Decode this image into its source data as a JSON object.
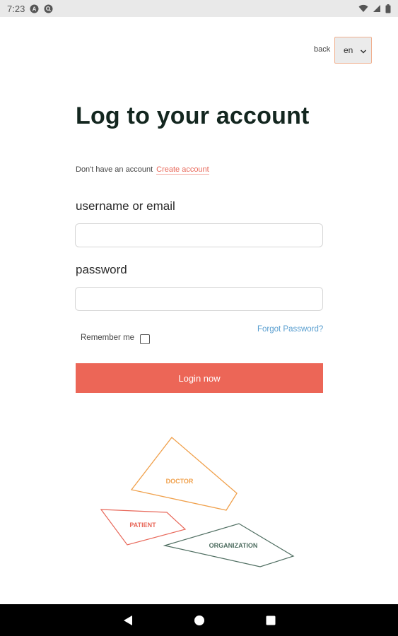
{
  "status_bar": {
    "time": "7:23",
    "left_icons": [
      "notification-a-icon",
      "search-badge-icon"
    ],
    "right_icons": [
      "wifi-icon",
      "signal-icon",
      "battery-icon"
    ]
  },
  "header": {
    "back_label": "back",
    "language": {
      "selected": "en"
    }
  },
  "page_title": "Log to your account",
  "signup": {
    "prompt": "Don't have an account",
    "link_label": "Create account"
  },
  "form": {
    "username_label": "username or email",
    "username_value": "",
    "password_label": "password",
    "password_value": "",
    "remember_label": "Remember me",
    "remember_checked": false,
    "forgot_label": "Forgot Password?",
    "login_label": "Login now"
  },
  "roles": {
    "doctor": "DOCTOR",
    "patient": "PATIENT",
    "organization": "ORGANIZATION"
  },
  "colors": {
    "accent": "#ec6657",
    "doctor": "#f0a04b",
    "patient": "#e8685a",
    "organization": "#4f6e61",
    "link": "#5a9fd0"
  },
  "nav_bar": {
    "icons": [
      "back-triangle-icon",
      "home-circle-icon",
      "recents-square-icon"
    ]
  }
}
